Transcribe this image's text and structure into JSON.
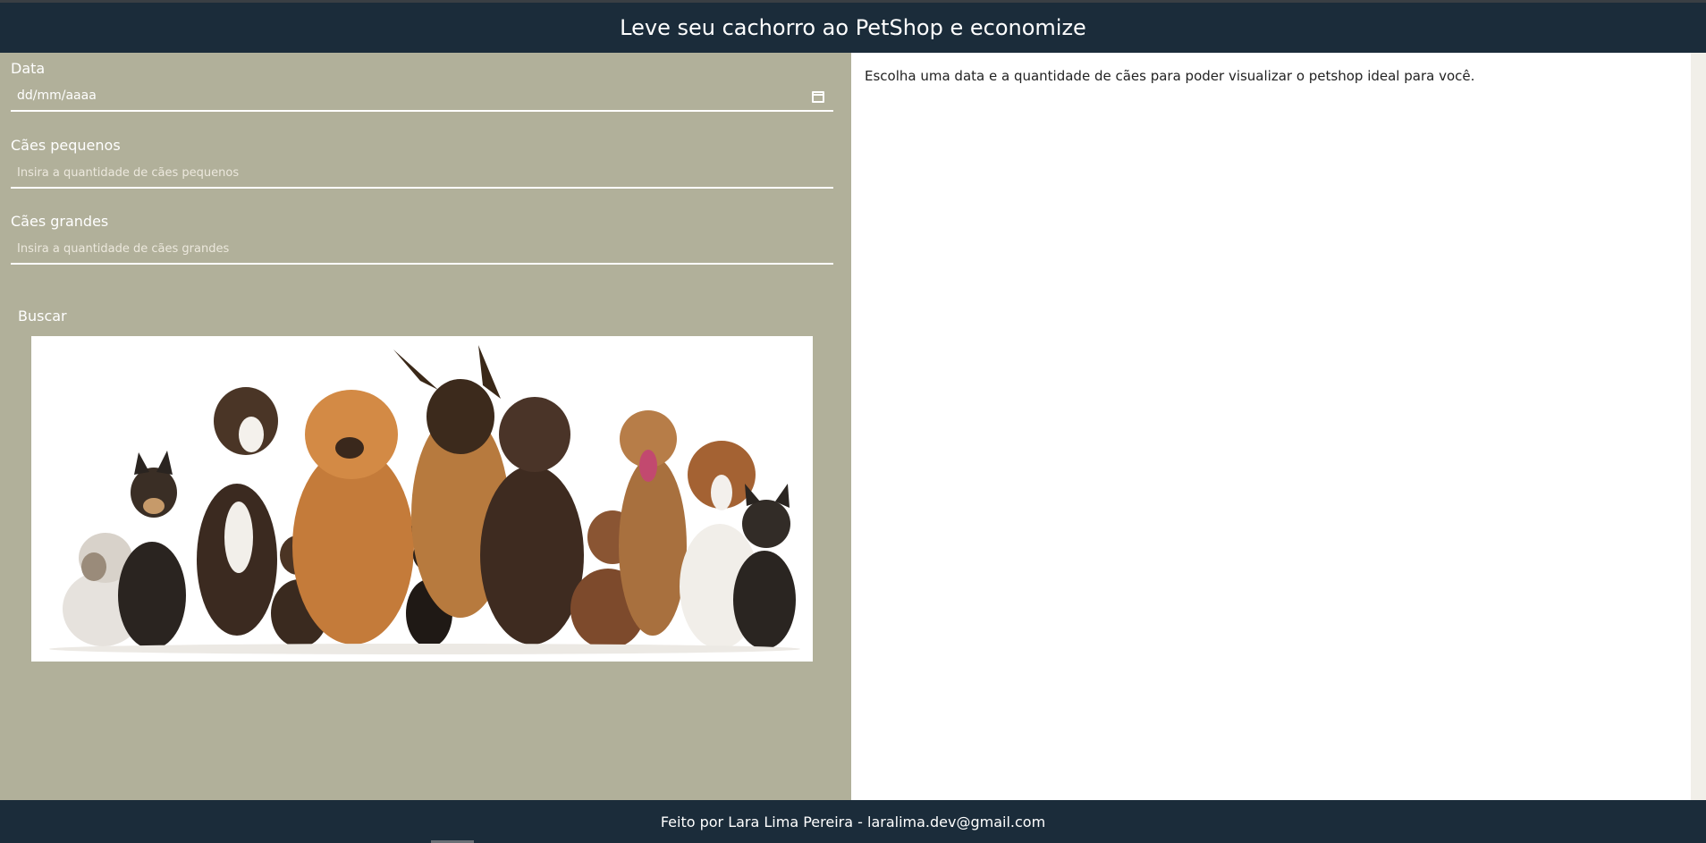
{
  "header": {
    "title": "Leve seu cachorro ao PetShop e economize"
  },
  "form": {
    "date": {
      "label": "Data",
      "value": "dd/mm/aaaa",
      "icon": "calendar-icon"
    },
    "small_dogs": {
      "label": "Cães pequenos",
      "placeholder": "Insira a quantidade de cães pequenos"
    },
    "large_dogs": {
      "label": "Cães grandes",
      "placeholder": "Insira a quantidade de cães grandes"
    },
    "search_button": "Buscar"
  },
  "result": {
    "message": "Escolha uma data e a quantidade de cães para poder visualizar o petshop ideal para você."
  },
  "footer": {
    "text": "Feito por Lara Lima Pereira - laralima.dev@gmail.com"
  },
  "colors": {
    "header_bg": "#1b2c3a",
    "left_panel_bg": "#b1b09a",
    "text_light": "#ffffff"
  }
}
